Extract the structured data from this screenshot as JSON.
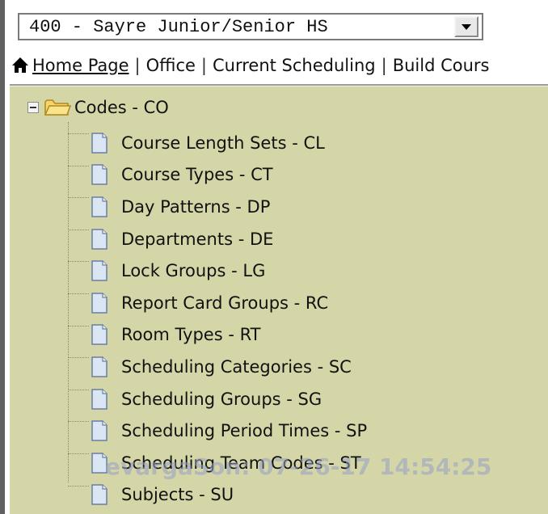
{
  "school_selector": {
    "selected_value": "400 - Sayre Junior/Senior HS",
    "dropdown_icon": "chevron-down-icon"
  },
  "nav": {
    "home_icon": "home-icon",
    "links": [
      "Home Page",
      "Office",
      "Current Scheduling",
      "Build Cours"
    ]
  },
  "tree": {
    "root_label": "Codes - CO",
    "root_icon": "folder-icon",
    "expander_icon": "collapse-icon",
    "items": [
      "Course Length Sets - CL",
      "Course Types - CT",
      "Day Patterns - DP",
      "Departments - DE",
      "Lock Groups - LG",
      "Report Card Groups - RC",
      "Room Types - RT",
      "Scheduling Categories - SC",
      "Scheduling Groups - SG",
      "Scheduling Period Times - SP",
      "Scheduling Team Codes - ST",
      "Subjects - SU"
    ]
  },
  "watermark": "evargaSon: 07-26-17 14:54:25",
  "colors": {
    "tree_background": "#d5d6a7",
    "page_icon_fill": "#dbe6f5",
    "folder_fill": "#f4d35e"
  }
}
